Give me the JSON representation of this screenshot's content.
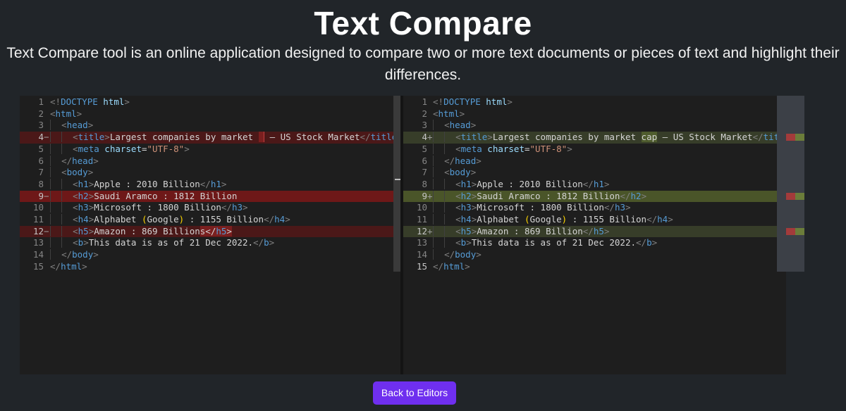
{
  "page": {
    "title": "Text Compare",
    "description": "Text Compare tool is an online application designed to compare two or more text documents or pieces of text and highlight their differences."
  },
  "left_editor": {
    "lines": [
      {
        "num": "1",
        "sign": "",
        "diff": null,
        "tokens": [
          [
            "p",
            "<!"
          ],
          [
            "t",
            "DOCTYPE "
          ],
          [
            "a",
            "html"
          ],
          [
            "p",
            ">"
          ]
        ]
      },
      {
        "num": "2",
        "sign": "",
        "diff": null,
        "tokens": [
          [
            "p",
            "<"
          ],
          [
            "t",
            "html"
          ],
          [
            "p",
            ">"
          ]
        ]
      },
      {
        "num": "3",
        "sign": "",
        "diff": null,
        "tokens": [
          [
            "i",
            "  "
          ],
          [
            "p",
            "<"
          ],
          [
            "t",
            "head"
          ],
          [
            "p",
            ">"
          ]
        ]
      },
      {
        "num": "4",
        "sign": "−",
        "diff": "del",
        "tokens": [
          [
            "i",
            "  "
          ],
          [
            "i",
            "  "
          ],
          [
            "p",
            "<"
          ],
          [
            "t",
            "title"
          ],
          [
            "p",
            ">"
          ],
          [
            "txt",
            "Largest companies by market "
          ],
          [
            "hl",
            " "
          ],
          [
            "txt",
            " — US Stock Market"
          ],
          [
            "p",
            "</"
          ],
          [
            "t",
            "title"
          ],
          [
            "p",
            ">"
          ]
        ]
      },
      {
        "num": "5",
        "sign": "",
        "diff": null,
        "tokens": [
          [
            "i",
            "  "
          ],
          [
            "i",
            "  "
          ],
          [
            "p",
            "<"
          ],
          [
            "t",
            "meta "
          ],
          [
            "a",
            "charset"
          ],
          [
            "txt",
            "="
          ],
          [
            "s",
            "\"UTF-8\""
          ],
          [
            "p",
            ">"
          ]
        ]
      },
      {
        "num": "6",
        "sign": "",
        "diff": null,
        "tokens": [
          [
            "i",
            "  "
          ],
          [
            "p",
            "</"
          ],
          [
            "t",
            "head"
          ],
          [
            "p",
            ">"
          ]
        ]
      },
      {
        "num": "7",
        "sign": "",
        "diff": null,
        "tokens": [
          [
            "i",
            "  "
          ],
          [
            "p",
            "<"
          ],
          [
            "t",
            "body"
          ],
          [
            "p",
            ">"
          ]
        ]
      },
      {
        "num": "8",
        "sign": "",
        "diff": null,
        "tokens": [
          [
            "i",
            "  "
          ],
          [
            "i",
            "  "
          ],
          [
            "p",
            "<"
          ],
          [
            "t",
            "h1"
          ],
          [
            "p",
            ">"
          ],
          [
            "txt",
            "Apple : 2010 Billion"
          ],
          [
            "p",
            "</"
          ],
          [
            "t",
            "h1"
          ],
          [
            "p",
            ">"
          ]
        ]
      },
      {
        "num": "9",
        "sign": "−",
        "diff": "del-full",
        "tokens": [
          [
            "i",
            "  "
          ],
          [
            "i",
            "  "
          ],
          [
            "p",
            "<"
          ],
          [
            "t",
            "h2"
          ],
          [
            "p",
            ">"
          ],
          [
            "txt",
            "Saudi Aramco : 1812 Billion"
          ]
        ]
      },
      {
        "num": "10",
        "sign": "",
        "diff": null,
        "tokens": [
          [
            "i",
            "  "
          ],
          [
            "i",
            "  "
          ],
          [
            "p",
            "<"
          ],
          [
            "t",
            "h3"
          ],
          [
            "p",
            ">"
          ],
          [
            "txt",
            "Microsoft : 1800 Billion"
          ],
          [
            "p",
            "</"
          ],
          [
            "t",
            "h3"
          ],
          [
            "p",
            ">"
          ]
        ]
      },
      {
        "num": "11",
        "sign": "",
        "diff": null,
        "tokens": [
          [
            "i",
            "  "
          ],
          [
            "i",
            "  "
          ],
          [
            "p",
            "<"
          ],
          [
            "t",
            "h4"
          ],
          [
            "p",
            ">"
          ],
          [
            "txt",
            "Alphabet "
          ],
          [
            "paren",
            "("
          ],
          [
            "txt",
            "Google"
          ],
          [
            "paren",
            ")"
          ],
          [
            "txt",
            " : 1155 Billion"
          ],
          [
            "p",
            "</"
          ],
          [
            "t",
            "h4"
          ],
          [
            "p",
            ">"
          ]
        ]
      },
      {
        "num": "12",
        "sign": "−",
        "diff": "del",
        "tokens": [
          [
            "i",
            "  "
          ],
          [
            "i",
            "  "
          ],
          [
            "p",
            "<"
          ],
          [
            "t",
            "h5"
          ],
          [
            "p",
            ">"
          ],
          [
            "txt",
            "Amazon : 869 Billion"
          ],
          [
            "hl",
            "s"
          ],
          [
            "hl",
            "</"
          ],
          [
            "hlt",
            "h5"
          ],
          [
            "hl",
            ">"
          ]
        ]
      },
      {
        "num": "13",
        "sign": "",
        "diff": null,
        "tokens": [
          [
            "i",
            "  "
          ],
          [
            "i",
            "  "
          ],
          [
            "p",
            "<"
          ],
          [
            "t",
            "b"
          ],
          [
            "p",
            ">"
          ],
          [
            "txt",
            "This data is as of 21 Dec 2022."
          ],
          [
            "p",
            "</"
          ],
          [
            "t",
            "b"
          ],
          [
            "p",
            ">"
          ]
        ]
      },
      {
        "num": "14",
        "sign": "",
        "diff": null,
        "tokens": [
          [
            "i",
            "  "
          ],
          [
            "p",
            "</"
          ],
          [
            "t",
            "body"
          ],
          [
            "p",
            ">"
          ]
        ]
      },
      {
        "num": "15",
        "sign": "",
        "diff": null,
        "tokens": [
          [
            "p",
            "</"
          ],
          [
            "t",
            "html"
          ],
          [
            "p",
            ">"
          ]
        ]
      }
    ]
  },
  "right_editor": {
    "lines": [
      {
        "num": "1",
        "sign": "",
        "diff": null,
        "tokens": [
          [
            "p",
            "<!"
          ],
          [
            "t",
            "DOCTYPE "
          ],
          [
            "a",
            "html"
          ],
          [
            "p",
            ">"
          ]
        ]
      },
      {
        "num": "2",
        "sign": "",
        "diff": null,
        "tokens": [
          [
            "p",
            "<"
          ],
          [
            "t",
            "html"
          ],
          [
            "p",
            ">"
          ]
        ]
      },
      {
        "num": "3",
        "sign": "",
        "diff": null,
        "tokens": [
          [
            "i",
            "  "
          ],
          [
            "p",
            "<"
          ],
          [
            "t",
            "head"
          ],
          [
            "p",
            ">"
          ]
        ]
      },
      {
        "num": "4",
        "sign": "+",
        "diff": "add",
        "tokens": [
          [
            "i",
            "  "
          ],
          [
            "i",
            "  "
          ],
          [
            "p",
            "<"
          ],
          [
            "t",
            "title"
          ],
          [
            "p",
            ">"
          ],
          [
            "txt",
            "Largest companies by market "
          ],
          [
            "hl",
            "cap"
          ],
          [
            "txt",
            " — US Stock Market"
          ],
          [
            "p",
            "</"
          ],
          [
            "t",
            "title"
          ],
          [
            "p",
            ">"
          ]
        ]
      },
      {
        "num": "5",
        "sign": "",
        "diff": null,
        "tokens": [
          [
            "i",
            "  "
          ],
          [
            "i",
            "  "
          ],
          [
            "p",
            "<"
          ],
          [
            "t",
            "meta "
          ],
          [
            "a",
            "charset"
          ],
          [
            "txt",
            "="
          ],
          [
            "s",
            "\"UTF-8\""
          ],
          [
            "p",
            ">"
          ]
        ]
      },
      {
        "num": "6",
        "sign": "",
        "diff": null,
        "tokens": [
          [
            "i",
            "  "
          ],
          [
            "p",
            "</"
          ],
          [
            "t",
            "head"
          ],
          [
            "p",
            ">"
          ]
        ]
      },
      {
        "num": "7",
        "sign": "",
        "diff": null,
        "tokens": [
          [
            "i",
            "  "
          ],
          [
            "p",
            "<"
          ],
          [
            "t",
            "body"
          ],
          [
            "p",
            ">"
          ]
        ]
      },
      {
        "num": "8",
        "sign": "",
        "diff": null,
        "tokens": [
          [
            "i",
            "  "
          ],
          [
            "i",
            "  "
          ],
          [
            "p",
            "<"
          ],
          [
            "t",
            "h1"
          ],
          [
            "p",
            ">"
          ],
          [
            "txt",
            "Apple : 2010 Billion"
          ],
          [
            "p",
            "</"
          ],
          [
            "t",
            "h1"
          ],
          [
            "p",
            ">"
          ]
        ]
      },
      {
        "num": "9",
        "sign": "+",
        "diff": "add-full",
        "tokens": [
          [
            "i",
            "  "
          ],
          [
            "i",
            "  "
          ],
          [
            "p",
            "<"
          ],
          [
            "t",
            "h2"
          ],
          [
            "p",
            ">"
          ],
          [
            "txt",
            "Saudi Aramco : 1812 Billion"
          ],
          [
            "p",
            "</"
          ],
          [
            "t",
            "h2"
          ],
          [
            "p",
            ">"
          ]
        ]
      },
      {
        "num": "10",
        "sign": "",
        "diff": null,
        "tokens": [
          [
            "i",
            "  "
          ],
          [
            "i",
            "  "
          ],
          [
            "p",
            "<"
          ],
          [
            "t",
            "h3"
          ],
          [
            "p",
            ">"
          ],
          [
            "txt",
            "Microsoft : 1800 Billion"
          ],
          [
            "p",
            "</"
          ],
          [
            "t",
            "h3"
          ],
          [
            "p",
            ">"
          ]
        ]
      },
      {
        "num": "11",
        "sign": "",
        "diff": null,
        "tokens": [
          [
            "i",
            "  "
          ],
          [
            "i",
            "  "
          ],
          [
            "p",
            "<"
          ],
          [
            "t",
            "h4"
          ],
          [
            "p",
            ">"
          ],
          [
            "txt",
            "Alphabet "
          ],
          [
            "paren",
            "("
          ],
          [
            "txt",
            "Google"
          ],
          [
            "paren",
            ")"
          ],
          [
            "txt",
            " : 1155 Billion"
          ],
          [
            "p",
            "</"
          ],
          [
            "t",
            "h4"
          ],
          [
            "p",
            ">"
          ]
        ]
      },
      {
        "num": "12",
        "sign": "+",
        "diff": "add",
        "tokens": [
          [
            "i",
            "  "
          ],
          [
            "i",
            "  "
          ],
          [
            "p",
            "<"
          ],
          [
            "t",
            "h5"
          ],
          [
            "p",
            ">"
          ],
          [
            "txt",
            "Amazon : 869 Billion"
          ],
          [
            "p",
            "</"
          ],
          [
            "t",
            "h5"
          ],
          [
            "p",
            ">"
          ]
        ]
      },
      {
        "num": "13",
        "sign": "",
        "diff": null,
        "tokens": [
          [
            "i",
            "  "
          ],
          [
            "i",
            "  "
          ],
          [
            "p",
            "<"
          ],
          [
            "t",
            "b"
          ],
          [
            "p",
            ">"
          ],
          [
            "txt",
            "This data is as of 21 Dec 2022."
          ],
          [
            "p",
            "</"
          ],
          [
            "t",
            "b"
          ],
          [
            "p",
            ">"
          ]
        ]
      },
      {
        "num": "14",
        "sign": "",
        "diff": null,
        "tokens": [
          [
            "i",
            "  "
          ],
          [
            "p",
            "</"
          ],
          [
            "t",
            "body"
          ],
          [
            "p",
            ">"
          ]
        ]
      },
      {
        "num": "15",
        "sign": "",
        "diff": null,
        "active": true,
        "tokens": [
          [
            "p",
            "</"
          ],
          [
            "t",
            "html"
          ],
          [
            "p",
            ">"
          ]
        ]
      }
    ]
  },
  "minimap": {
    "marks": [
      {
        "row": 4,
        "colors": [
          "#a33b3b",
          "#6b7d3a"
        ]
      },
      {
        "row": 9,
        "colors": [
          "#a33b3b",
          "#6b7d3a"
        ]
      },
      {
        "row": 12,
        "colors": [
          "#a33b3b",
          "#6b7d3a"
        ]
      }
    ]
  },
  "colors": {
    "background": "#212529",
    "editor_background": "#1e1e1e",
    "removed_line": "#4b1818",
    "inserted_line": "#373d29",
    "button": "#6f2fef"
  },
  "actions": {
    "back_label": "Back to Editors"
  }
}
